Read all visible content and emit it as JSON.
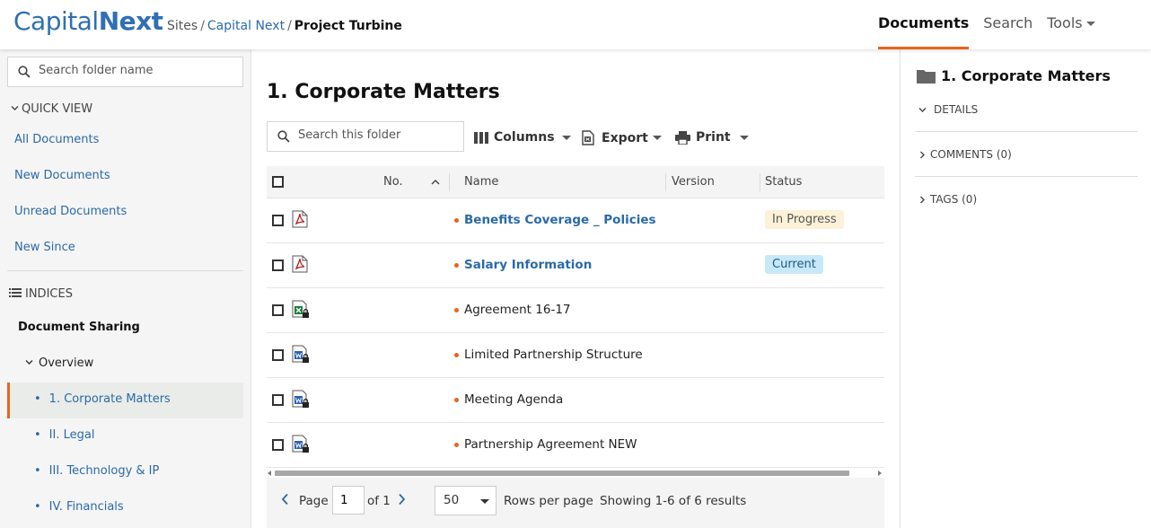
{
  "app": {
    "logo_part1": "Capital",
    "logo_part2": "Next",
    "brand_color": "#2f6fb3",
    "accent_color": "#e8641b"
  },
  "breadcrumb": {
    "items": [
      "Sites",
      "Capital Next",
      "Project Turbine"
    ],
    "separator": "/"
  },
  "topnav": {
    "documents": "Documents",
    "search": "Search",
    "tools": "Tools"
  },
  "sidebar": {
    "search_placeholder": "Search folder name",
    "quick_view_title": "QUICK VIEW",
    "quick_links": [
      "All Documents",
      "New Documents",
      "Unread Documents",
      "New Since"
    ],
    "indices_title": "INDICES",
    "tree_root": "Document Sharing",
    "tree_group": "Overview",
    "tree_items": [
      "1. Corporate Matters",
      "II. Legal",
      "III. Technology & IP",
      "IV. Financials"
    ],
    "selected_index": 0
  },
  "main": {
    "title": "1. Corporate Matters",
    "search_placeholder": "Search this folder",
    "toolbar": {
      "columns": "Columns",
      "export": "Export",
      "print": "Print"
    },
    "table": {
      "headers": {
        "no": "No.",
        "name": "Name",
        "version": "Version",
        "status": "Status"
      },
      "rows": [
        {
          "name": "Benefits Coverage _ Policies",
          "type": "pdf-icon",
          "status": "In Progress",
          "link": true
        },
        {
          "name": "Salary Information",
          "type": "pdf-icon",
          "status": "Current",
          "link": true
        },
        {
          "name": "Agreement 16-17",
          "type": "excel-locked-icon",
          "status": "",
          "link": false
        },
        {
          "name": "Limited Partnership Structure",
          "type": "word-locked-icon",
          "status": "",
          "link": false
        },
        {
          "name": "Meeting Agenda",
          "type": "word-locked-icon",
          "status": "",
          "link": false
        },
        {
          "name": "Partnership Agreement NEW",
          "type": "word-locked-icon",
          "status": "",
          "link": false
        }
      ]
    },
    "pager": {
      "page_label": "Page",
      "current_page": "1",
      "of_label": "of 1",
      "rows_value": "50",
      "rows_label": "Rows per page",
      "summary": "Showing 1-6 of 6 results"
    }
  },
  "right_panel": {
    "title": "1. Corporate Matters",
    "details": "DETAILS",
    "comments": "COMMENTS (0)",
    "tags": "TAGS (0)"
  }
}
